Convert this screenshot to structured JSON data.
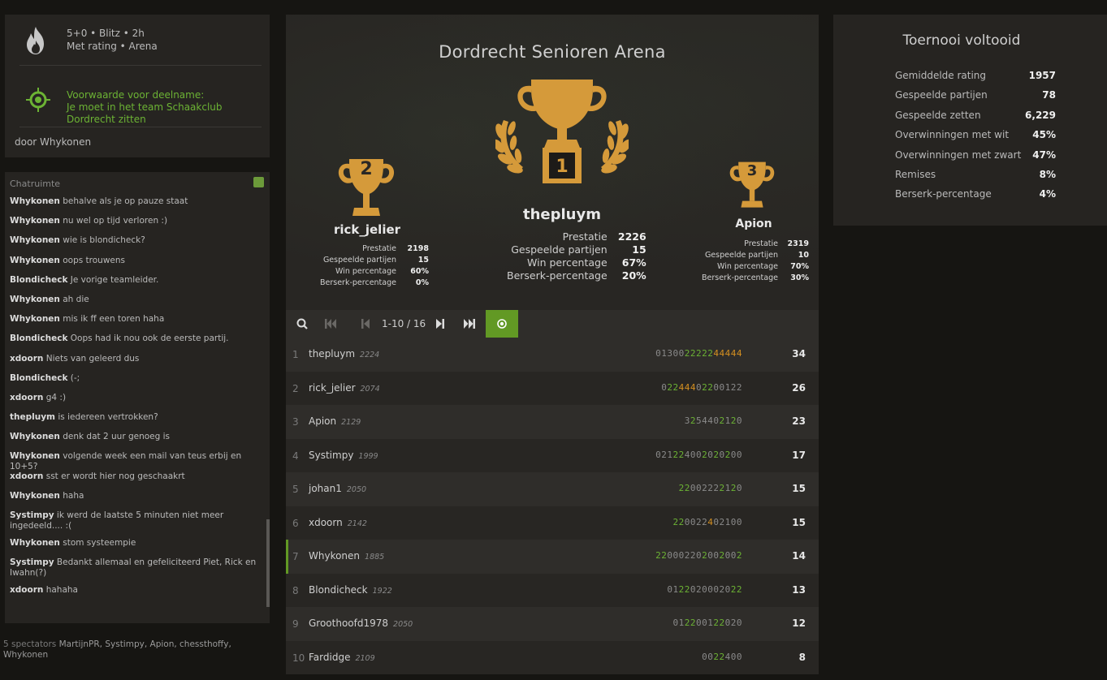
{
  "tournament": {
    "line1": "5+0 • Blitz • 2h",
    "line2": "Met rating • Arena",
    "condition_title": "Voorwaarde voor deelname:",
    "condition_text": "Je moet in het team Schaakclub Dordrecht zitten",
    "by": "door Whykonen"
  },
  "chat": {
    "title": "Chatruimte",
    "messages": [
      {
        "user": "Whykonen",
        "text": "behalve als je op pauze staat"
      },
      {
        "user": "Whykonen",
        "text": "nu wel op tijd verloren :)"
      },
      {
        "user": "Whykonen",
        "text": "wie is blondicheck?"
      },
      {
        "user": "Whykonen",
        "text": "oops trouwens"
      },
      {
        "user": "Blondicheck",
        "text": "Je vorige teamleider."
      },
      {
        "user": "Whykonen",
        "text": "ah die"
      },
      {
        "user": "Whykonen",
        "text": "mis ik ff een toren haha"
      },
      {
        "user": "Blondicheck",
        "text": "Oops had ik nou ook de eerste partij."
      },
      {
        "user": "xdoorn",
        "text": "Niets van geleerd dus"
      },
      {
        "user": "Blondicheck",
        "text": "(-;"
      },
      {
        "user": "xdoorn",
        "text": "g4 :)"
      },
      {
        "user": "thepluym",
        "text": "is iedereen vertrokken?"
      },
      {
        "user": "Whykonen",
        "text": "denk dat 2 uur genoeg is"
      },
      {
        "user": "Whykonen",
        "text": "volgende week een mail van teus erbij en 10+5?"
      },
      {
        "user": "xdoorn",
        "text": "sst er wordt hier nog geschaakrt"
      },
      {
        "user": "Whykonen",
        "text": "haha"
      },
      {
        "user": "Systimpy",
        "text": "ik werd de laatste 5 minuten niet meer ingedeeld.... :("
      },
      {
        "user": "Whykonen",
        "text": "stom systeempie"
      },
      {
        "user": "Systimpy",
        "text": "Bedankt allemaal en gefeliciteerd Piet, Rick en Iwahn(?)"
      },
      {
        "user": "xdoorn",
        "text": "hahaha"
      }
    ]
  },
  "spectators": {
    "label": "5 spectators",
    "names": "MartijnPR, Systimpy, Apion, chessthoffy, Whykonen"
  },
  "podium": {
    "title": "Dordrecht Senioren Arena",
    "first": {
      "rank": "1",
      "name": "thepluym",
      "performance": "2226",
      "games": "15",
      "win": "67%",
      "berserk": "20%"
    },
    "second": {
      "rank": "2",
      "name": "rick_jelier",
      "performance": "2198",
      "games": "15",
      "win": "60%",
      "berserk": "0%"
    },
    "third": {
      "rank": "3",
      "name": "Apion",
      "performance": "2319",
      "games": "10",
      "win": "70%",
      "berserk": "30%"
    },
    "labels": {
      "performance": "Prestatie",
      "games": "Gespeelde partijen",
      "win": "Win percentage",
      "berserk": "Berserk-percentage"
    }
  },
  "pager": {
    "count": "1-10 / 16"
  },
  "standings": [
    {
      "rank": "1",
      "name": "thepluym",
      "rating": "2224",
      "sheet": "01300|2222244444",
      "score": "34",
      "me": false
    },
    {
      "rank": "2",
      "name": "rick_jelier",
      "rating": "2074",
      "sheet": "0|22444|0|22|00|1|22",
      "score": "26",
      "me": false
    },
    {
      "rank": "3",
      "name": "Apion",
      "rating": "2129",
      "sheet": "3|2|544|02120",
      "score": "23",
      "me": false
    },
    {
      "rank": "4",
      "name": "Systimpy",
      "rating": "1999",
      "sheet": "021|22|4|002020200",
      "score": "17",
      "me": false
    },
    {
      "rank": "5",
      "name": "johan1",
      "rating": "2050",
      "sheet": "|2200|222|2120",
      "score": "15",
      "me": false
    },
    {
      "rank": "6",
      "name": "xdoorn",
      "rating": "2142",
      "sheet": "|2200|22|4|02100",
      "score": "15",
      "me": false
    },
    {
      "rank": "7",
      "name": "Whykonen",
      "rating": "1885",
      "sheet": "|22000|22|02002002",
      "score": "14",
      "me": true
    },
    {
      "rank": "8",
      "name": "Blondicheck",
      "rating": "1922",
      "sheet": "01|22|0200020|22",
      "score": "13",
      "me": false
    },
    {
      "rank": "9",
      "name": "Groothoofd1978",
      "rating": "2050",
      "sheet": "01|22|001|22|020",
      "score": "12",
      "me": false
    },
    {
      "rank": "10",
      "name": "Fardidge",
      "rating": "2109",
      "sheet": "00|22|4|00",
      "score": "8",
      "me": false
    }
  ],
  "stats": {
    "title": "Toernooi voltooid",
    "rows": [
      {
        "k": "Gemiddelde rating",
        "v": "1957"
      },
      {
        "k": "Gespeelde partijen",
        "v": "78"
      },
      {
        "k": "Gespeelde zetten",
        "v": "6,229"
      },
      {
        "k": "Overwinningen met wit",
        "v": "45%"
      },
      {
        "k": "Overwinningen met zwart",
        "v": "47%"
      },
      {
        "k": "Remises",
        "v": "8%"
      },
      {
        "k": "Berserk-percentage",
        "v": "4%"
      }
    ]
  },
  "colors": {
    "accent": "#629924",
    "gold": "#d59020",
    "green": "#6cb334"
  }
}
